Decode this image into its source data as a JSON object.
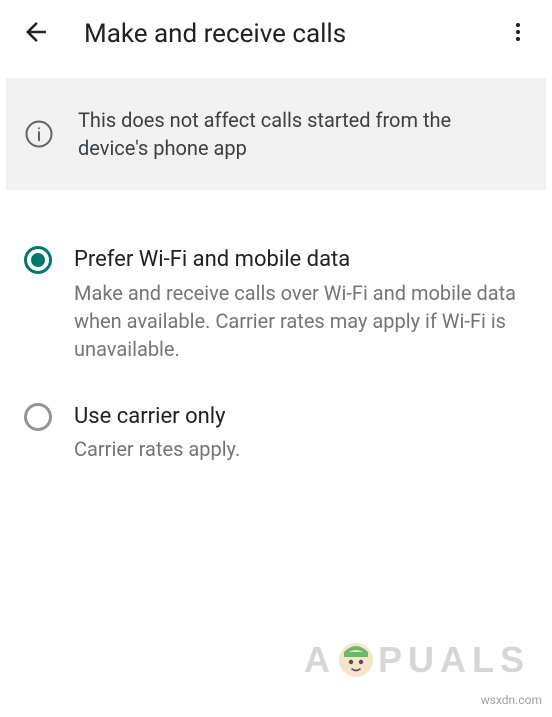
{
  "header": {
    "title": "Make and receive calls"
  },
  "banner": {
    "text": "This does not affect calls started from the device's phone app"
  },
  "options": [
    {
      "title": "Prefer Wi-Fi and mobile data",
      "description": "Make and receive calls over Wi-Fi and mobile data when available. Carrier rates may apply if Wi-Fi is unavailable.",
      "selected": true
    },
    {
      "title": "Use carrier only",
      "description": "Carrier rates apply.",
      "selected": false
    }
  ],
  "watermark": {
    "prefix": "A",
    "suffix": "PUALS"
  },
  "attribution": "wsxdn.com"
}
